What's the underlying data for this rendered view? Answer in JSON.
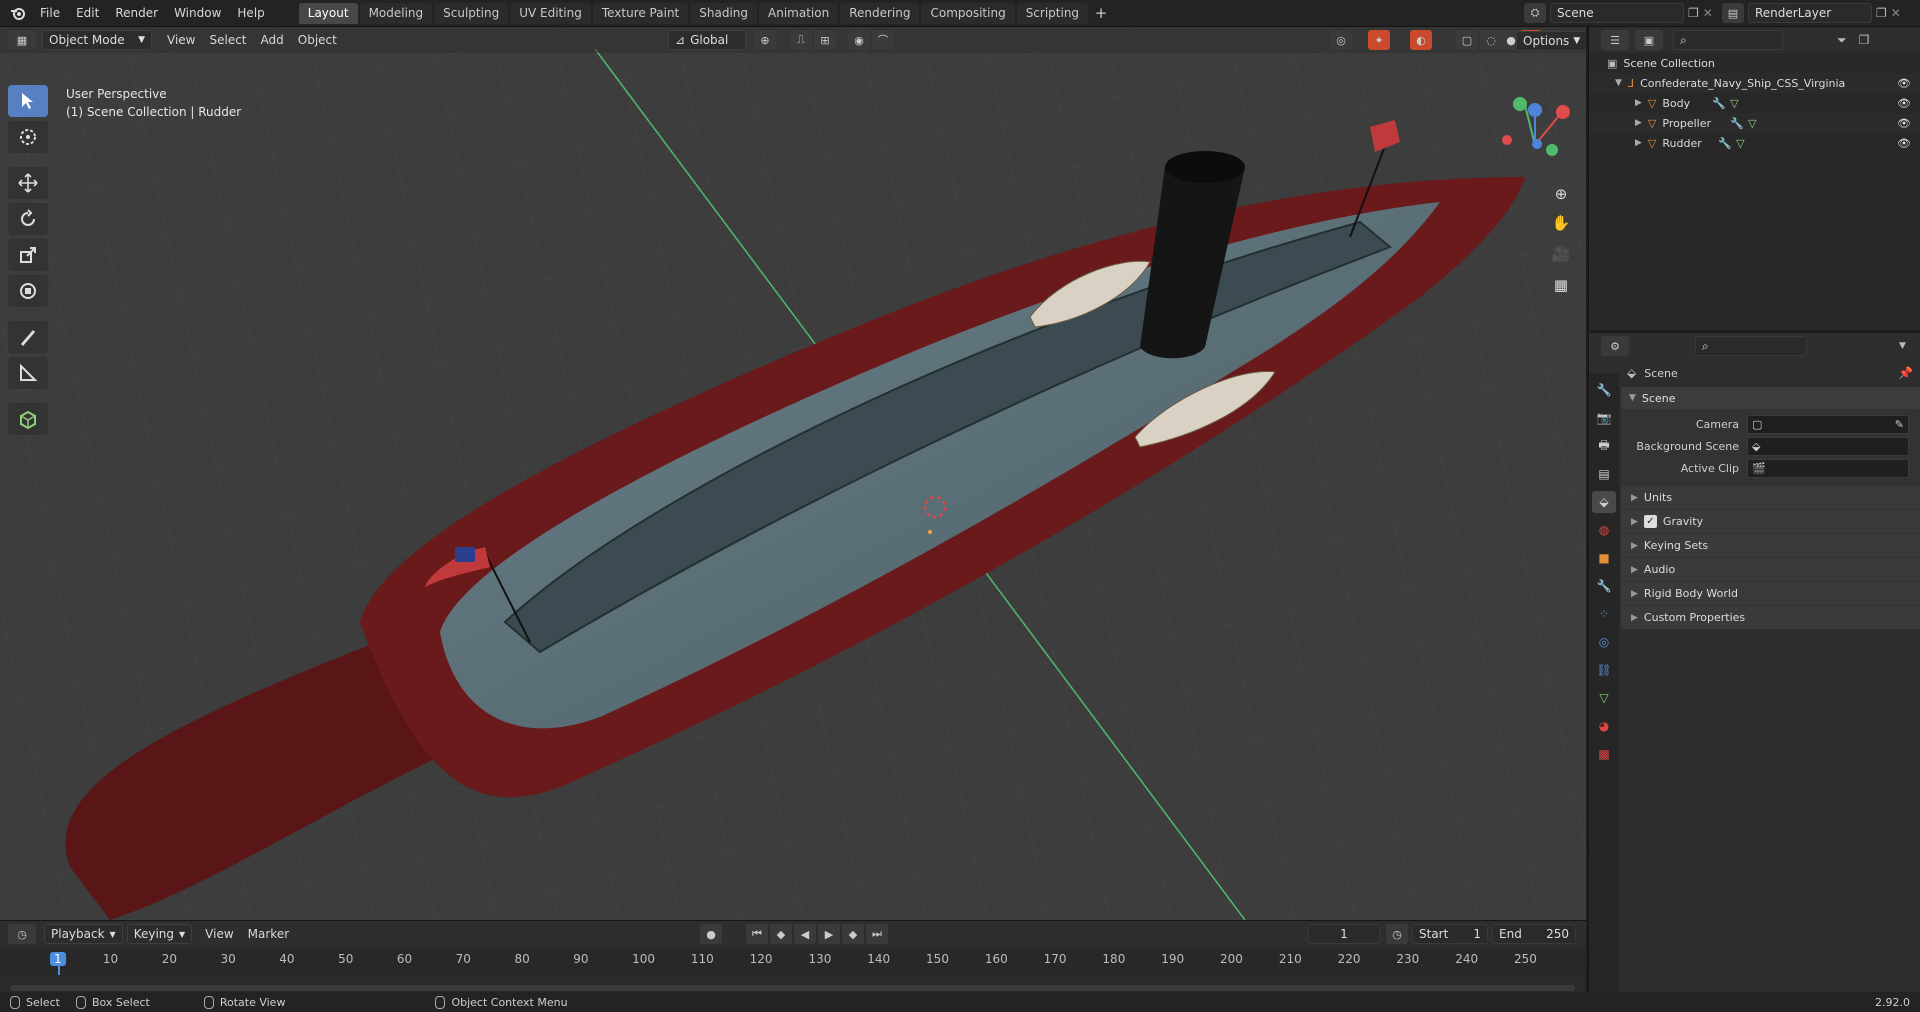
{
  "menu": [
    "File",
    "Edit",
    "Render",
    "Window",
    "Help"
  ],
  "workspaces": [
    "Layout",
    "Modeling",
    "Sculpting",
    "UV Editing",
    "Texture Paint",
    "Shading",
    "Animation",
    "Rendering",
    "Compositing",
    "Scripting"
  ],
  "active_workspace": "Layout",
  "scene_selector": {
    "value": "Scene"
  },
  "view_layer_selector": {
    "value": "RenderLayer"
  },
  "viewport": {
    "mode": "Object Mode",
    "header_menu": [
      "View",
      "Select",
      "Add",
      "Object"
    ],
    "transform_orientation": "Global",
    "options_label": "Options",
    "info_line1": "User Perspective",
    "info_line2": "(1) Scene Collection | Rudder",
    "colors": {
      "grid_y_axis": "#4dbb6a",
      "background": "#3d3d3d",
      "hull_red": "#5a1516",
      "deck": "#51666f"
    }
  },
  "tools": [
    "select-box",
    "cursor",
    "move",
    "rotate",
    "scale",
    "transform",
    "annotate",
    "measure",
    "add-cube"
  ],
  "outliner": {
    "root": "Scene Collection",
    "collection": "Confederate_Navy_Ship_CSS_Virginia",
    "objects": [
      "Body",
      "Propeller",
      "Rudder"
    ]
  },
  "properties": {
    "header": "Scene",
    "panel": "Scene",
    "fields": [
      {
        "label": "Camera",
        "value": ""
      },
      {
        "label": "Background Scene",
        "value": ""
      },
      {
        "label": "Active Clip",
        "value": ""
      }
    ],
    "subpanels": [
      "Units",
      "Gravity",
      "Keying Sets",
      "Audio",
      "Rigid Body World",
      "Custom Properties"
    ],
    "gravity_checked": true
  },
  "timeline": {
    "menu": [
      "Playback",
      "Keying",
      "View",
      "Marker"
    ],
    "current_frame": "1",
    "start_label": "Start",
    "start": "1",
    "end_label": "End",
    "end": "250",
    "ruler_marks": [
      "1",
      "10",
      "20",
      "30",
      "40",
      "50",
      "60",
      "70",
      "80",
      "90",
      "100",
      "110",
      "120",
      "130",
      "140",
      "150",
      "160",
      "170",
      "180",
      "190",
      "200",
      "210",
      "220",
      "230",
      "240",
      "250"
    ]
  },
  "statusbar": {
    "items": [
      "Select",
      "Box Select",
      "Rotate View",
      "Object Context Menu"
    ],
    "version": "2.92.0"
  }
}
